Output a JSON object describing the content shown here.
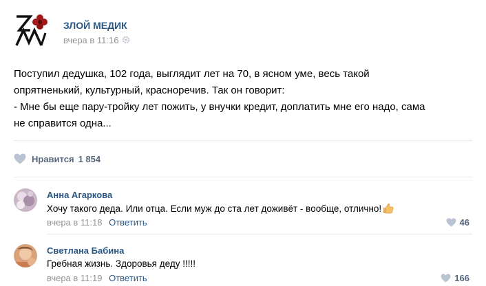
{
  "post": {
    "group_name": "ЗЛОЙ МЕДИК",
    "time": "вчера в 11:16",
    "text_lines": [
      "Поступил дедушка, 102 года, выглядит лет на 70, в ясном уме, весь такой",
      "опрятненький, культурный, красноречив. Так он говорит:",
      "- Мне бы еще пару-тройку лет пожить, у внучки кредит, доплатить мне его надо, сама",
      "не справится одна..."
    ],
    "likes_label": "Нравится",
    "likes_count": "1 854",
    "icons": [
      "logo",
      "gear-icon",
      "heart-icon"
    ]
  },
  "comments": [
    {
      "author": "Анна Агаркова",
      "text": "Хочу такого деда. Или отца. Если муж до ста лет доживёт - вообще, отлично!",
      "time": "вчера в 11:18",
      "reply_label": "Ответить",
      "likes": "46",
      "emoji": "thumbs-up-icon"
    },
    {
      "author": "Светлана Бабина",
      "text": "Гребная жизнь. Здоровья деду !!!!!",
      "time": "вчера в 11:19",
      "reply_label": "Ответить",
      "likes": "166"
    }
  ],
  "colors": {
    "link": "#2a5885",
    "muted": "#939393",
    "like_text": "#55677d",
    "heart": "#b9c4d2",
    "divider": "#e7e8ec",
    "logo_red": "#a01818"
  }
}
